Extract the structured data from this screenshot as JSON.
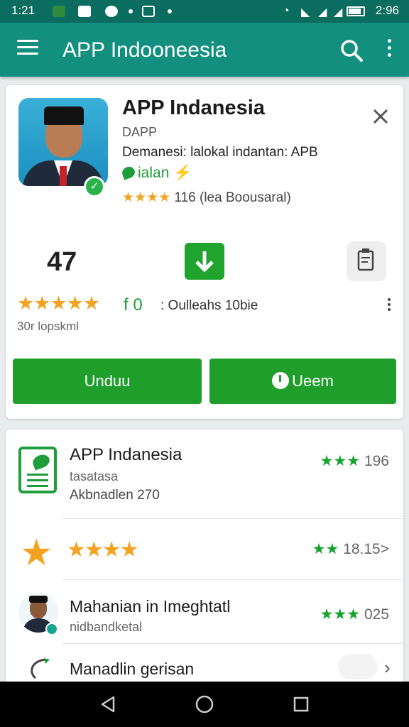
{
  "status_bar": {
    "time": "1:21",
    "clock_right": "2:96"
  },
  "app_bar": {
    "title": "APP Indooneesia",
    "search_icon": "search-icon",
    "menu_icon": "hamburger-icon",
    "more_icon": "more-vert-icon"
  },
  "app_card": {
    "name": "APP Indanesia",
    "developer": "DAPP",
    "description": "Demanesi: lalokal indantan: APB",
    "tag": "ialan",
    "rating_text": "116 (lea Boousaral)",
    "stat_number": "47",
    "review_text": "30r lopskml",
    "size_value": "f 0",
    "size_desc": ": Oulleahs 10bie",
    "install_button": "Unduu",
    "open_button": "Ueem",
    "colors": {
      "primary": "#138f7f",
      "status": "#0b6d60",
      "button": "#1f9e2c",
      "star": "#f4a320"
    }
  },
  "list": [
    {
      "name": "APP Indanesia",
      "sub1": "tasatasa",
      "sub2": "Akbnadlen 270",
      "stars": "★★★",
      "rating": "196"
    },
    {
      "stars_left": "★★★★",
      "stars": "★★",
      "rating": "18.15>"
    },
    {
      "name": "Mahanian in Imeghtatl",
      "sub1": "nidbandketal",
      "stars": "★★★",
      "rating": "025"
    },
    {
      "name": "Manadlin gerisan"
    }
  ]
}
